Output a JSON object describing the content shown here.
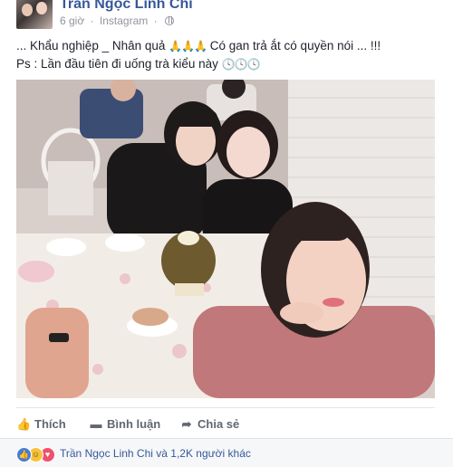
{
  "post": {
    "author": "Trần Ngọc Linh Chi",
    "time": "6 giờ",
    "separator": "·",
    "source": "Instagram",
    "privacy_icon": "globe-icon",
    "text_line1_part1": "... Khẩu nghiệp _ Nhân quả",
    "text_line1_emoji": "🙏🙏🙏",
    "text_line1_part2": "Có gan trả ắt có quyền nói ... !!!",
    "text_line2": "Ps : Lần đầu tiên đi uống trà kiểu này",
    "text_line2_emoji": "🕓🕓🕓"
  },
  "actions": {
    "like_label": "Thích",
    "comment_label": "Bình luận",
    "share_label": "Chia sẻ",
    "like_icon": "thumbs-up-icon",
    "comment_icon": "comment-icon",
    "share_icon": "share-arrow-icon"
  },
  "reactions": {
    "summary": "Trần Ngọc Linh Chi và 1,2K người khác",
    "types": [
      "like",
      "haha",
      "love"
    ]
  },
  "colors": {
    "link": "#365899",
    "meta": "#90949c",
    "action": "#616770",
    "like": "#4a7bd0",
    "haha": "#f5c33b",
    "love": "#f0506e"
  }
}
